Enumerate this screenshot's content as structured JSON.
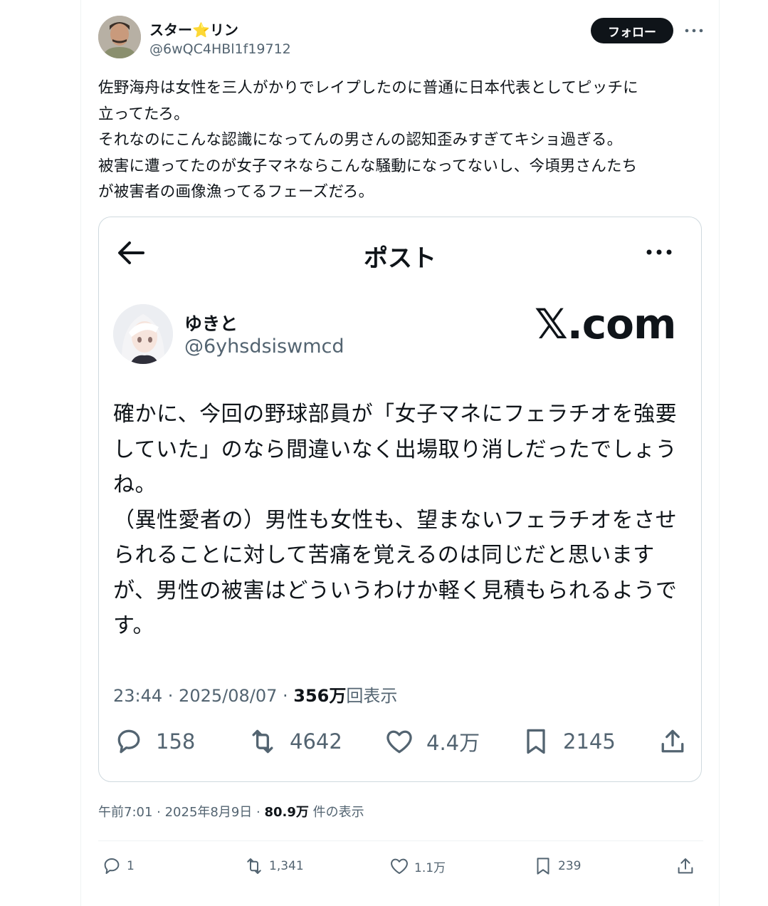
{
  "author": {
    "display_name": "スター⭐️リン",
    "handle": "@6wQC4HBl1f19712",
    "follow_label": "フォロー"
  },
  "tweet": {
    "lines": [
      "佐野海舟は女性を三人がかりでレイプしたのに普通に日本代表としてピッチに",
      "立ってたろ。",
      "それなのにこんな認識になってんの男さんの認知歪みすぎてキショ過ぎる。",
      "被害に遭ってたのが女子マネならこんな騒動になってないし、今頃男さんたち",
      "が被害者の画像漁ってるフェーズだろ。"
    ]
  },
  "embedded_screenshot": {
    "screen_title": "ポスト",
    "watermark": "𝕏.com",
    "author": {
      "display_name": "ゆきと",
      "handle": "@6yhsdsiswmcd"
    },
    "lines": [
      "確かに、今回の野球部員が「女子マネにフェラチオを強要",
      "していた」のなら間違いなく出場取り消しだったでしょう",
      "ね。",
      "（異性愛者の）男性も女性も、望まないフェラチオをさせ",
      "られることに対して苦痛を覚えるのは同じだと思います",
      "が、男性の被害はどういうわけか軽く見積もられるようで",
      "す。"
    ],
    "meta": {
      "time_date": "23:44 · 2025/08/07 · ",
      "views_value": "356万",
      "views_label": "回表示"
    },
    "actions": {
      "replies": "158",
      "reposts": "4642",
      "likes": "4.4万",
      "bookmarks": "2145"
    }
  },
  "meta": {
    "time_date": "午前7:01 · 2025年8月9日 · ",
    "views_value": "80.9万",
    "views_label": " 件の表示"
  },
  "actions": {
    "replies": "1",
    "reposts": "1,341",
    "likes": "1.1万",
    "bookmarks": "239"
  },
  "colors": {
    "text": "#0f1419",
    "secondary": "#536471",
    "border": "#cfd9de",
    "button": "#0f1419"
  }
}
